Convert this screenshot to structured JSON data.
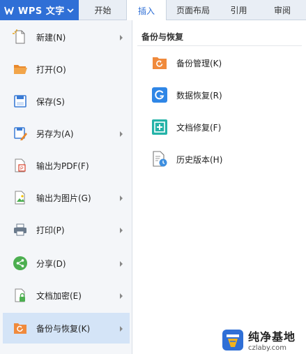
{
  "app": {
    "title": "WPS 文字"
  },
  "tabs": [
    {
      "label": "开始",
      "active": false
    },
    {
      "label": "插入",
      "active": true
    },
    {
      "label": "页面布局",
      "active": false
    },
    {
      "label": "引用",
      "active": false
    },
    {
      "label": "审阅",
      "active": false
    }
  ],
  "menu": [
    {
      "label": "新建(N)",
      "icon": "new-file-icon",
      "has_submenu": true
    },
    {
      "label": "打开(O)",
      "icon": "open-folder-icon",
      "has_submenu": false
    },
    {
      "label": "保存(S)",
      "icon": "save-disk-icon",
      "has_submenu": false
    },
    {
      "label": "另存为(A)",
      "icon": "save-as-icon",
      "has_submenu": true
    },
    {
      "label": "输出为PDF(F)",
      "icon": "export-pdf-icon",
      "has_submenu": false
    },
    {
      "label": "输出为图片(G)",
      "icon": "export-image-icon",
      "has_submenu": true
    },
    {
      "label": "打印(P)",
      "icon": "printer-icon",
      "has_submenu": true
    },
    {
      "label": "分享(D)",
      "icon": "share-icon",
      "has_submenu": true
    },
    {
      "label": "文档加密(E)",
      "icon": "encrypt-icon",
      "has_submenu": true
    },
    {
      "label": "备份与恢复(K)",
      "icon": "backup-restore-icon",
      "has_submenu": true,
      "active": true
    }
  ],
  "submenu": {
    "title": "备份与恢复",
    "items": [
      {
        "label": "备份管理(K)",
        "icon": "backup-management-icon"
      },
      {
        "label": "数据恢复(R)",
        "icon": "data-recovery-icon"
      },
      {
        "label": "文档修复(F)",
        "icon": "document-repair-icon"
      },
      {
        "label": "历史版本(H)",
        "icon": "history-version-icon"
      }
    ]
  },
  "watermark": {
    "main": "纯净基地",
    "sub": "czlaby.com"
  },
  "colors": {
    "brand_blue": "#2f6fd6",
    "active_item_bg": "#d4e4f7",
    "menu_bg": "#f4f6f9"
  }
}
